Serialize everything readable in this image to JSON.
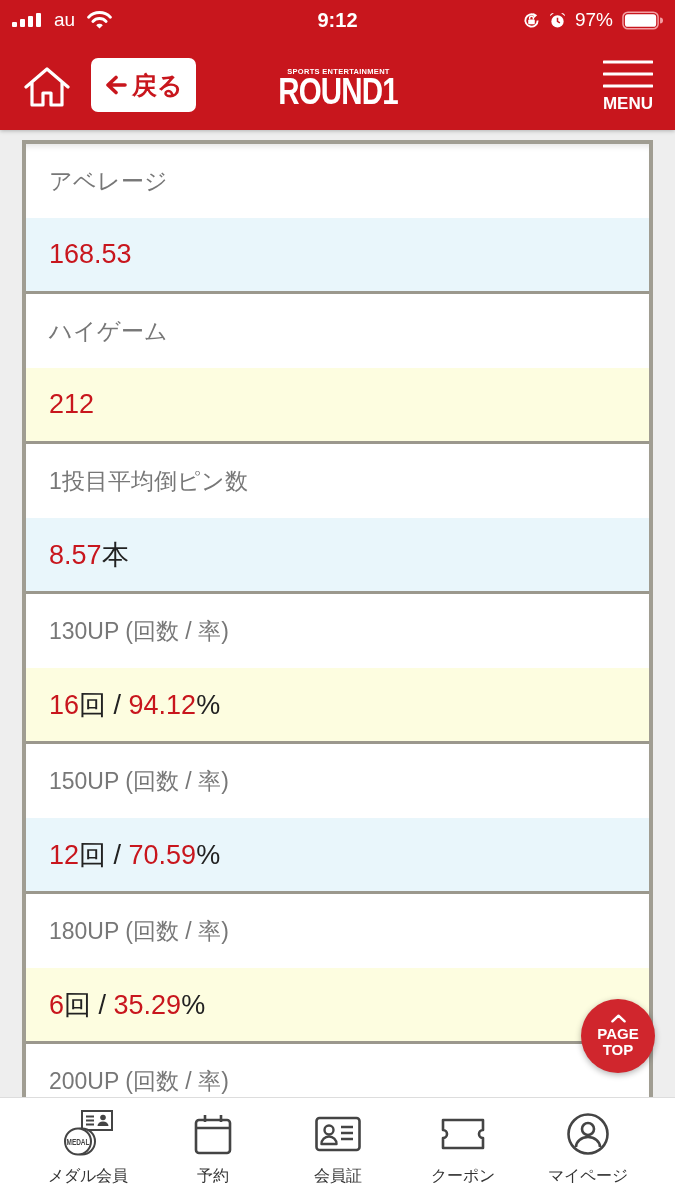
{
  "status_bar": {
    "carrier": "au",
    "time": "9:12",
    "battery": "97%"
  },
  "header": {
    "back_button": "戻る",
    "logo": {
      "tagline": "SPORTS ENTERTAINMENT",
      "name": "ROUND1"
    },
    "menu_label": "MENU"
  },
  "stats": [
    {
      "label": "アベレージ",
      "value": [
        {
          "kind": "number",
          "text": "168.53"
        }
      ]
    },
    {
      "label": "ハイゲーム",
      "value": [
        {
          "kind": "number",
          "text": "212"
        }
      ]
    },
    {
      "label": "1投目平均倒ピン数",
      "value": [
        {
          "kind": "number",
          "text": "8.57"
        },
        {
          "kind": "unit",
          "text": "本"
        }
      ]
    },
    {
      "label": "130UP (回数 / 率)",
      "value": [
        {
          "kind": "number",
          "text": "16"
        },
        {
          "kind": "unit",
          "text": "回 / "
        },
        {
          "kind": "number",
          "text": "94.12"
        },
        {
          "kind": "unit",
          "text": "%"
        }
      ]
    },
    {
      "label": "150UP (回数 / 率)",
      "value": [
        {
          "kind": "number",
          "text": "12"
        },
        {
          "kind": "unit",
          "text": "回 / "
        },
        {
          "kind": "number",
          "text": "70.59"
        },
        {
          "kind": "unit",
          "text": "%"
        }
      ]
    },
    {
      "label": "180UP (回数 / 率)",
      "value": [
        {
          "kind": "number",
          "text": "6"
        },
        {
          "kind": "unit",
          "text": "回 / "
        },
        {
          "kind": "number",
          "text": "35.29"
        },
        {
          "kind": "unit",
          "text": "%"
        }
      ]
    },
    {
      "label": "200UP (回数 / 率)"
    }
  ],
  "page_top_button": "PAGE TOP",
  "bottom_nav": [
    {
      "kind": "medal",
      "label": "メダル会員",
      "icon_text": "MEDAL"
    },
    {
      "kind": "calendar",
      "label": "予約"
    },
    {
      "kind": "card",
      "label": "会員証"
    },
    {
      "kind": "ticket",
      "label": "クーポン"
    },
    {
      "kind": "user",
      "label": "マイページ"
    }
  ]
}
